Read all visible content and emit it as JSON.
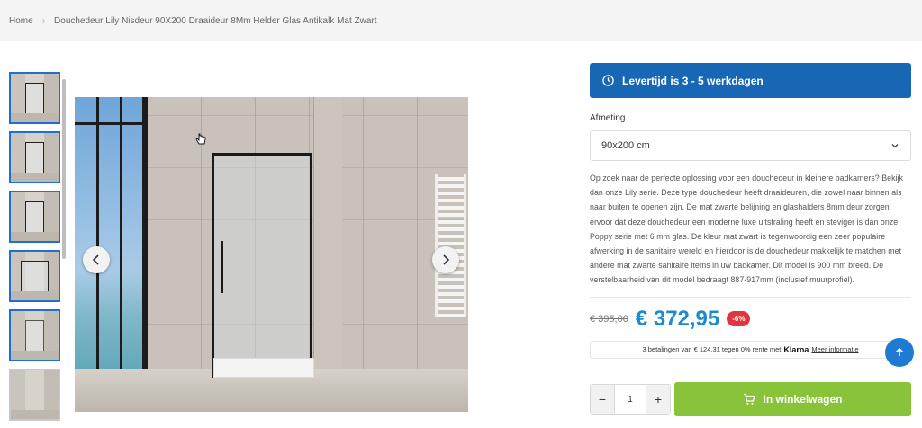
{
  "breadcrumb": {
    "home": "Home",
    "current": "Douchedeur Lily Nisdeur 90X200 Draaideur 8Mm Helder Glas Antikalk Mat Zwart"
  },
  "gallery": {
    "thumbnail_count": 6
  },
  "delivery": {
    "text": "Levertijd is 3 - 5 werkdagen"
  },
  "options": {
    "label": "Afmeting",
    "selected": "90x200 cm"
  },
  "description": "Op zoek naar de perfecte oplossing voor een douchedeur in kleinere badkamers? Bekijk dan onze Lily serie. Deze type douchedeur heeft draaideuren, die zowel naar binnen als naar buiten te openen zijn. De mat zwarte belijning en glashalders 8mm deur zorgen ervoor dat deze douchedeur een moderne luxe uitstraling heeft en steviger is dan onze Poppy serie met 6 mm glas. De kleur mat zwart is tegenwoordig een zeer populaire afwerking in de sanitaire wereld en hierdoor is de douchedeur makkelijk te matchen met andere mat zwarte sanitaire items in uw badkamer. Dit model is 900 mm breed. De verstelbaarheid van dit model bedraagt 887-917mm (inclusief muurprofiel).",
  "price": {
    "old": "€ 395,00",
    "new": "€ 372,95",
    "discount": "-6%"
  },
  "klarna": {
    "text": "3 betalingen van € 124,31 tegen 0% rente met",
    "brand": "Klarna",
    "more": "Meer informatie"
  },
  "cart": {
    "minus": "−",
    "quantity": "1",
    "plus": "+",
    "button_label": "In winkelwagen"
  },
  "colors": {
    "banner": "#1767b5",
    "price": "#1b8bd0",
    "discount": "#e0353d",
    "cart": "#88c33a",
    "scroll_top": "#1f7bd1"
  }
}
